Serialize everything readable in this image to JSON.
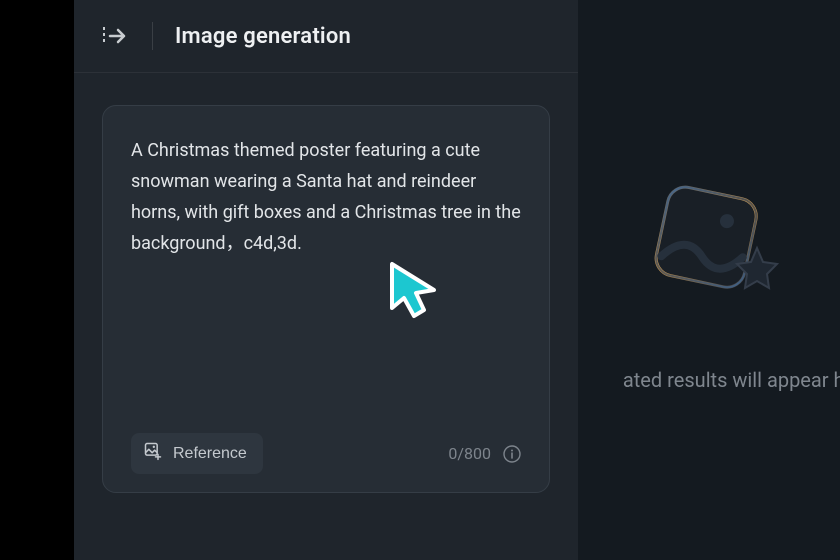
{
  "header": {
    "title": "Image generation"
  },
  "prompt": {
    "value": "A Christmas themed poster featuring a cute snowman wearing a Santa hat and reindeer horns, with gift boxes and a Christmas tree in the background，c4d,3d.",
    "reference_label": "Reference",
    "counter": "0/800"
  },
  "preview": {
    "placeholder_text": "ated results will appear he"
  }
}
